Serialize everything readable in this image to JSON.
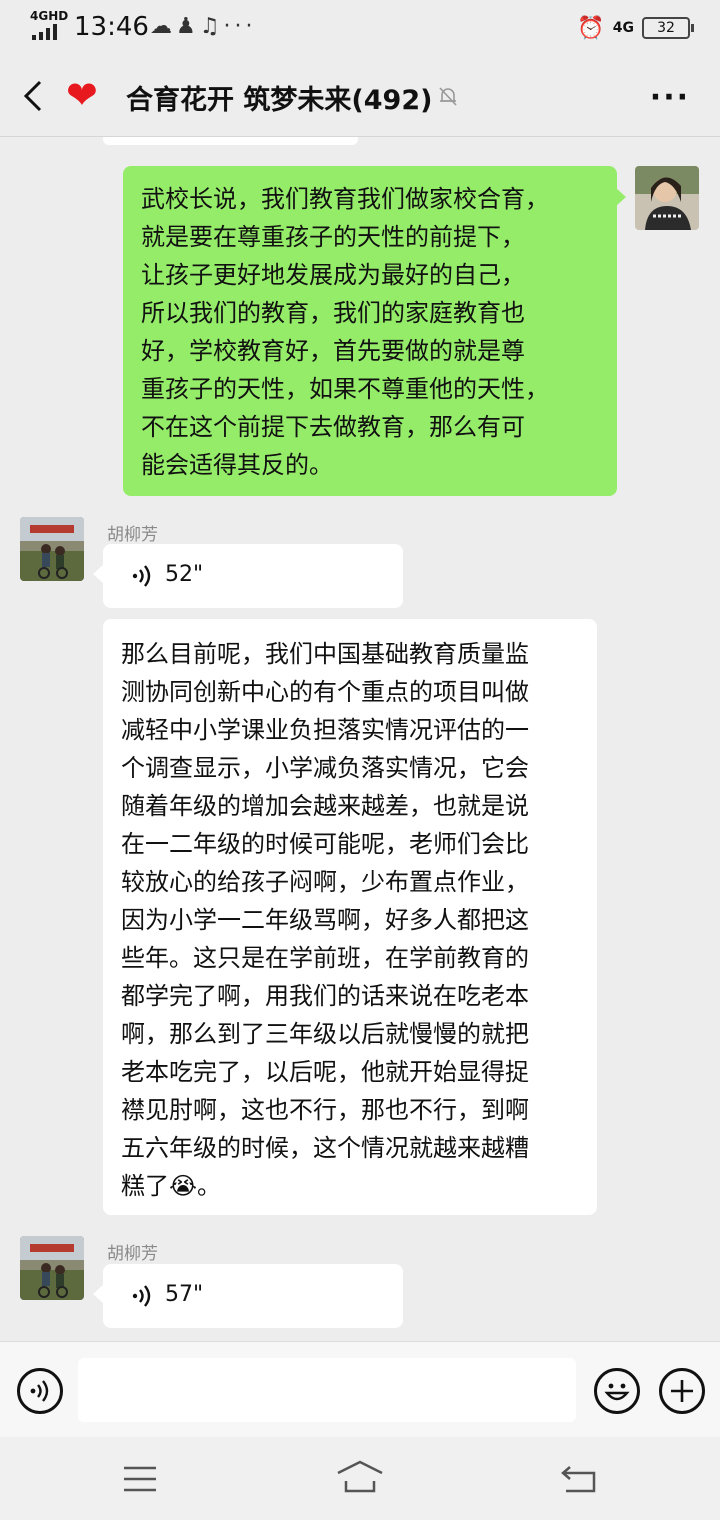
{
  "status_bar": {
    "network": "4GHD",
    "time": "13:46",
    "right_network": "4G",
    "battery": "32"
  },
  "header": {
    "title": "合育花开 筑梦未来(492)"
  },
  "messages": {
    "m1": {
      "text": "武校长说，我们教育我们做家校合育，\n就是要在尊重孩子的天性的前提下，\n让孩子更好地发展成为最好的自己，\n所以我们的教育，我们的家庭教育也\n好，学校教育好，首先要做的就是尊\n重孩子的天性，如果不尊重他的天性，\n不在这个前提下去做教育，那么有可\n能会适得其反的。"
    },
    "m2": {
      "sender": "胡柳芳",
      "duration": "52\""
    },
    "m3": {
      "text": "那么目前呢，我们中国基础教育质量监\n测协同创新中心的有个重点的项目叫做\n减轻中小学课业负担落实情况评估的一\n个调查显示，小学减负落实情况，它会\n随着年级的增加会越来越差，也就是说\n在一二年级的时候可能呢，老师们会比\n较放心的给孩子闷啊，少布置点作业，\n因为小学一二年级骂啊，好多人都把这\n些年。这只是在学前班，在学前教育的\n都学完了啊，用我们的话来说在吃老本\n啊，那么到了三年级以后就慢慢的就把\n老本吃完了，以后呢，他就开始显得捉\n襟见肘啊，这也不行，那也不行，到啊\n五六年级的时候，这个情况就越来越糟\n糕了😭。"
    },
    "m4": {
      "sender": "胡柳芳",
      "duration": "57\""
    }
  },
  "colors": {
    "bubble_self": "#95ec69",
    "bubble_other": "#ffffff",
    "background": "#ededed"
  }
}
